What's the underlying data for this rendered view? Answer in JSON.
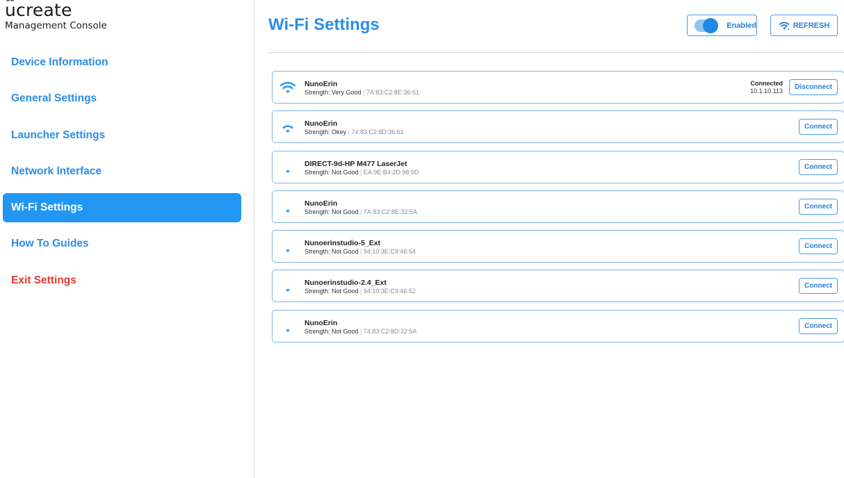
{
  "brand": {
    "name": "ucreate",
    "name_rest": "create",
    "name_first": "u",
    "subtitle": "Management Console"
  },
  "sidebar": {
    "items": [
      {
        "label": "Device Information",
        "name": "sidebar-item-device-information",
        "active": false,
        "danger": false
      },
      {
        "label": "General Settings",
        "name": "sidebar-item-general-settings",
        "active": false,
        "danger": false
      },
      {
        "label": "Launcher Settings",
        "name": "sidebar-item-launcher-settings",
        "active": false,
        "danger": false
      },
      {
        "label": "Network Interface",
        "name": "sidebar-item-network-interface",
        "active": false,
        "danger": false
      },
      {
        "label": "Wi-Fi Settings",
        "name": "sidebar-item-wifi-settings",
        "active": true,
        "danger": false
      },
      {
        "label": "How To Guides",
        "name": "sidebar-item-how-to-guides",
        "active": false,
        "danger": false
      },
      {
        "label": "Exit Settings",
        "name": "sidebar-item-exit-settings",
        "active": false,
        "danger": true
      }
    ]
  },
  "header": {
    "title": "Wi-Fi Settings",
    "toggle_label": "Enabled",
    "toggle_on": true,
    "refresh_label": "REFRESH"
  },
  "colors": {
    "accent": "#2196f3",
    "link": "#2b8ee6",
    "danger": "#e5392f",
    "border": "#7fb4e6"
  },
  "networks": [
    {
      "name": "NunoErin",
      "strength_label": "Strength: Very Good",
      "mac": "7A:83:C2:8E:36:61",
      "signal_bars": 3,
      "status": "Connected",
      "ip": "10.1.10.113",
      "action": "Disconnect"
    },
    {
      "name": "NunoErin",
      "strength_label": "Strength: Okey",
      "mac": "74:83:C2:8D:36:61",
      "signal_bars": 2,
      "status": "",
      "ip": "",
      "action": "Connect"
    },
    {
      "name": "DIRECT-9d-HP M477 LaserJet",
      "strength_label": "Strength: Not Good",
      "mac": "EA:9E:B4:2D:98:9D",
      "signal_bars": 1,
      "status": "",
      "ip": "",
      "action": "Connect"
    },
    {
      "name": "NunoErin",
      "strength_label": "Strength: Not Good",
      "mac": "7A:83:C2:8E:32:5A",
      "signal_bars": 1,
      "status": "",
      "ip": "",
      "action": "Connect"
    },
    {
      "name": "Nunoerinstudio-5_Ext",
      "strength_label": "Strength: Not Good",
      "mac": "94:10:3E:C9:46:54",
      "signal_bars": 1,
      "status": "",
      "ip": "",
      "action": "Connect"
    },
    {
      "name": "Nunoerinstudio-2.4_Ext",
      "strength_label": "Strength: Not Good",
      "mac": "94:10:3E:C9:46:52",
      "signal_bars": 1,
      "status": "",
      "ip": "",
      "action": "Connect"
    },
    {
      "name": "NunoErin",
      "strength_label": "Strength: Not Good",
      "mac": "74:83:C2:8D:32:5A",
      "signal_bars": 1,
      "status": "",
      "ip": "",
      "action": "Connect"
    }
  ]
}
